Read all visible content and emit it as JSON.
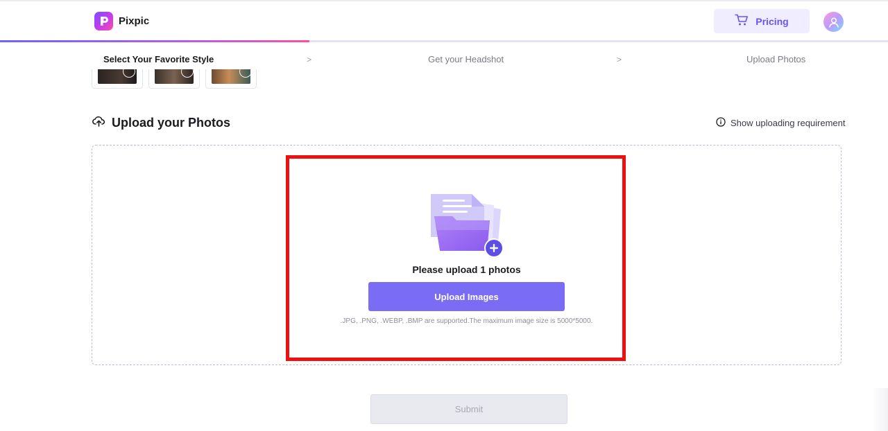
{
  "app": {
    "name": "Pixpic"
  },
  "header": {
    "pricing_label": "Pricing"
  },
  "steps": [
    {
      "label": "Select Your Favorite Style",
      "active": true
    },
    {
      "label": "Get your Headshot",
      "active": false
    },
    {
      "label": "Upload Photos",
      "active": false
    }
  ],
  "step_separator": ">",
  "progress": {
    "fraction": 0.35
  },
  "upload_section": {
    "title": "Upload your Photos",
    "requirement_link": "Show uploading requirement",
    "message": "Please upload 1 photos",
    "button_label": "Upload Images",
    "support_text": ".JPG, .PNG, .WEBP, .BMP are supported.The maximum image size is 5000*5000."
  },
  "submit_label": "Submit",
  "icons": {
    "logo": "pixpic-logo-icon",
    "cart": "cart-icon",
    "avatar": "user-avatar-icon",
    "upload_cloud": "cloud-upload-icon",
    "info": "info-circle-icon",
    "folder": "folder-add-icon"
  },
  "colors": {
    "accent": "#7b6cf6",
    "pricing_bg": "#efedff",
    "pricing_text": "#6656f2",
    "highlight_border": "#ee0f0f"
  }
}
